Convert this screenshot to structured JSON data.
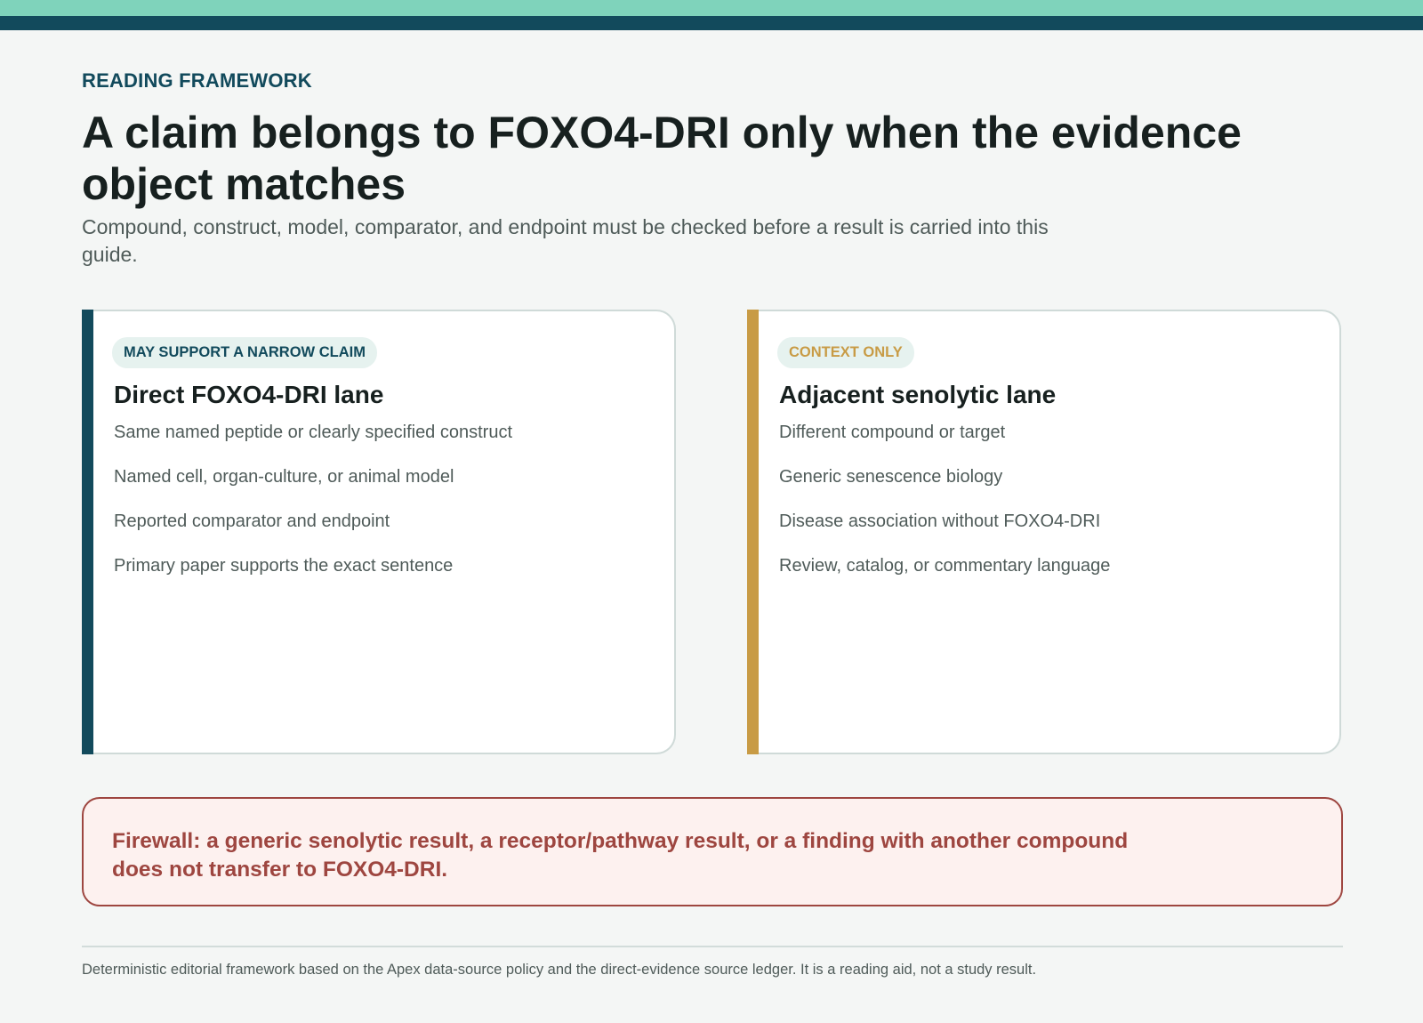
{
  "header": {
    "eyebrow": "READING FRAMEWORK",
    "title": "A claim belongs to FOXO4-DRI only when the evidence object matches",
    "subtitle": "Compound, construct, model, comparator, and endpoint must be checked before a result is carried into this guide."
  },
  "colors": {
    "accent_teal": "#124a5c",
    "accent_mint": "#7fd3bb",
    "accent_gold": "#c89b45",
    "warning_red": "#9e4640"
  },
  "lanes": [
    {
      "badge": "MAY SUPPORT A NARROW CLAIM",
      "title": "Direct FOXO4-DRI lane",
      "items": [
        "Same named peptide or clearly specified construct",
        "Named cell, organ-culture, or animal model",
        "Reported comparator and endpoint",
        "Primary paper supports the exact sentence"
      ]
    },
    {
      "badge": "CONTEXT ONLY",
      "title": "Adjacent senolytic lane",
      "items": [
        "Different compound or target",
        "Generic senescence biology",
        "Disease association without FOXO4-DRI",
        "Review, catalog, or commentary language"
      ]
    }
  ],
  "firewall": {
    "text": "Firewall: a generic senolytic result, a receptor/pathway result, or a finding with another compound does not transfer to FOXO4-DRI."
  },
  "footer": {
    "note": "Deterministic editorial framework based on the Apex data-source policy and the direct-evidence source ledger. It is a reading aid, not a study result."
  }
}
